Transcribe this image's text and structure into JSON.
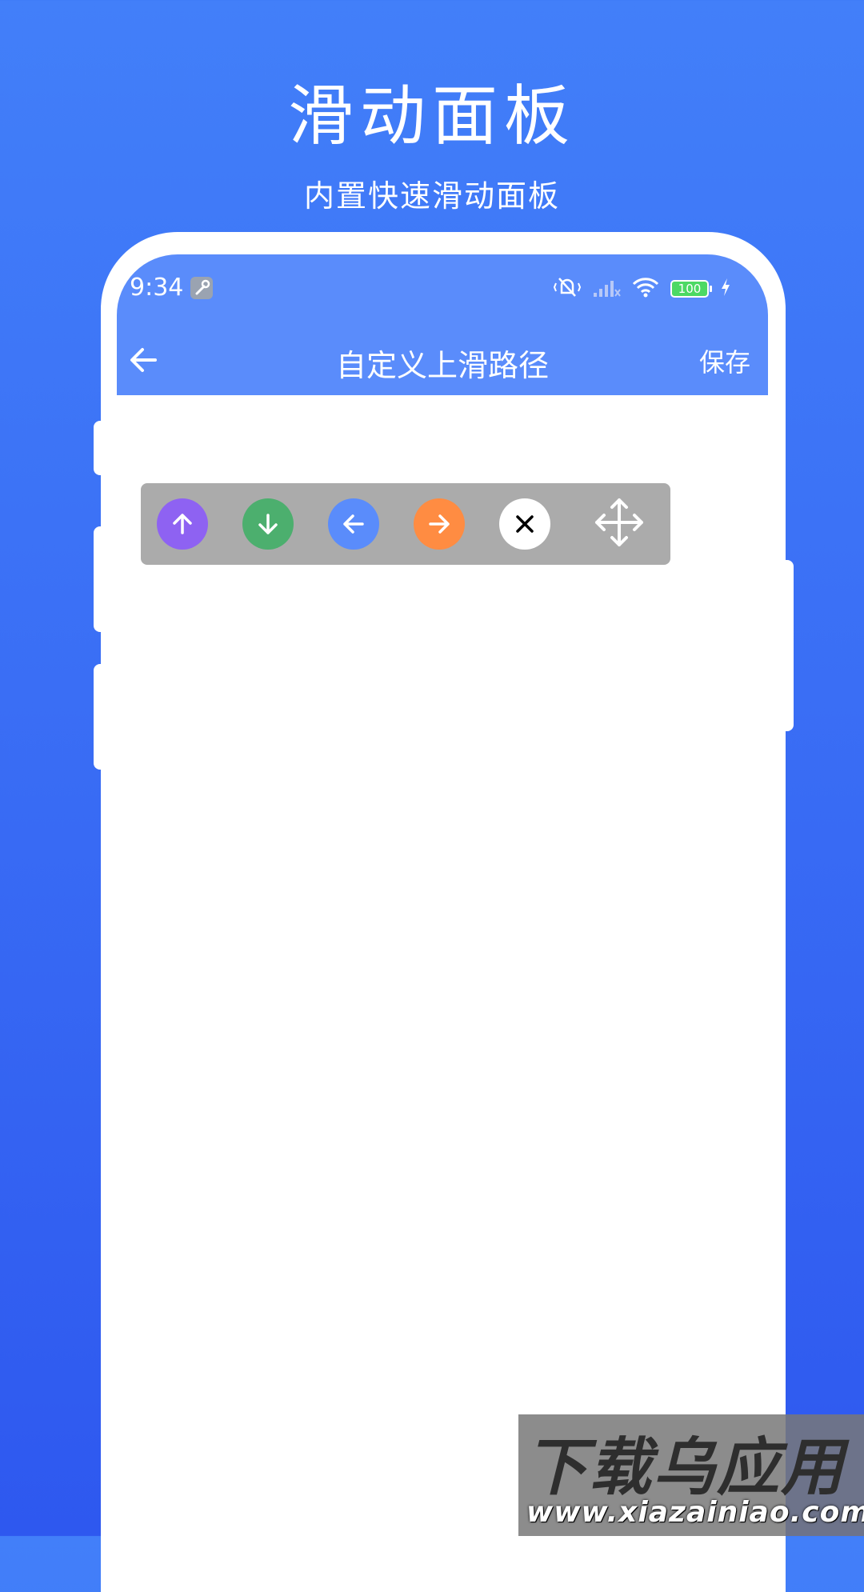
{
  "promo": {
    "title": "滑动面板",
    "subtitle": "内置快速滑动面板"
  },
  "status_bar": {
    "time": "9:34",
    "battery": "100",
    "icons": [
      "wrench-icon",
      "mute-vibrate-icon",
      "signal-icon",
      "wifi-icon",
      "battery-icon",
      "charging-icon"
    ]
  },
  "app_bar": {
    "back_icon": "back-arrow-icon",
    "title": "自定义上滑路径",
    "save_label": "保存"
  },
  "swipe_panel": {
    "buttons": [
      {
        "icon": "arrow-up-icon",
        "color": "#8e62f2"
      },
      {
        "icon": "arrow-down-icon",
        "color": "#4caf6e"
      },
      {
        "icon": "arrow-left-icon",
        "color": "#5a8cfb"
      },
      {
        "icon": "arrow-right-icon",
        "color": "#ff8c42"
      },
      {
        "icon": "close-icon",
        "color": "#ffffff"
      },
      {
        "icon": "move-icon",
        "color": "#ffffff"
      }
    ]
  },
  "watermark": {
    "text": "下载乌应用",
    "url": "www.xiazainiao.com"
  },
  "colors": {
    "background": "#3a6ef5",
    "app_bar": "#5a8cfb",
    "panel": "#ababab"
  }
}
